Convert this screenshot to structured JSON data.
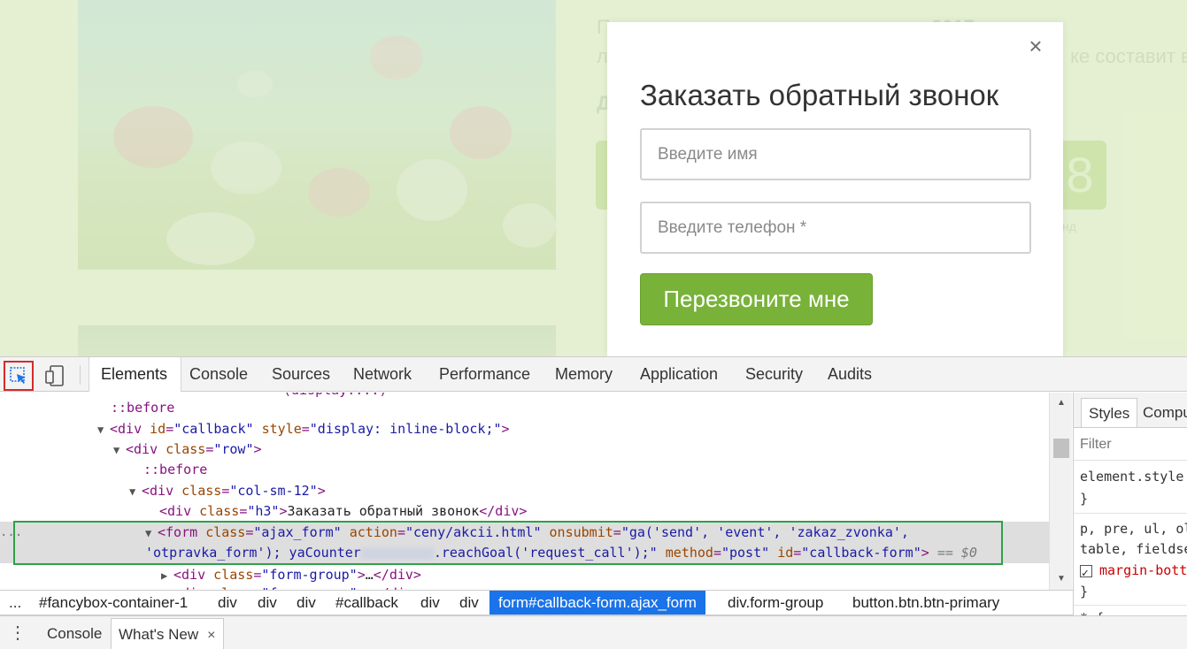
{
  "background_page": {
    "text_line1_start": "П",
    "text_line1_year": "2017",
    "text_line1_end": "цена на",
    "text_line2_start": "л",
    "text_line2_end": "ке составит в",
    "text_line3_start": "Д",
    "counter_digit": "8",
    "counter_label": "нд"
  },
  "modal": {
    "close_label": "×",
    "title": "Заказать обратный звонок",
    "name_placeholder": "Введите имя",
    "phone_placeholder": "Введите телефон *",
    "submit_label": "Перезвоните мне"
  },
  "devtools": {
    "tabs": [
      "Elements",
      "Console",
      "Sources",
      "Network",
      "Performance",
      "Memory",
      "Application",
      "Security",
      "Audits"
    ],
    "active_tab": "Elements",
    "dom": {
      "line_top_partial": "(display:...)",
      "before1": "::before",
      "div_callback_tag": "div",
      "div_callback_id_attr": "id",
      "div_callback_id_val": "\"callback\"",
      "div_callback_style_attr": "style",
      "div_callback_style_val": "\"display: inline-block;\"",
      "row_class_val": "\"row\"",
      "before2": "::before",
      "col_class_val": "\"col-sm-12\"",
      "h3_class_val": "\"h3\"",
      "h3_text": "Заказать обратный звонок",
      "form_class_val": "\"ajax_form\"",
      "form_action_val": "\"ceny/akcii.html\"",
      "form_onsubmit_val": "\"ga('send', 'event', 'zakaz_zvonka',",
      "form_onsubmit_val2": "'otpravka_form'); yaCounter",
      "form_onsubmit_val3": ".reachGoal('request_call');\"",
      "form_method_val": "\"post\"",
      "form_id_val": "\"callback-form\"",
      "dollar_ref": "== $0",
      "form_group_class_val": "\"form-group\"",
      "collapsed_ellipsis": "…",
      "left_dots": "..."
    },
    "styles": {
      "tabs": [
        "Styles",
        "Computed"
      ],
      "filter_placeholder": "Filter",
      "element_style": "element.style {",
      "close_brace": "}",
      "selector_line1": "p, pre, ul, ol,",
      "selector_line2": "table, fieldset",
      "property": "margin-bottom",
      "next_rule": "* {"
    },
    "breadcrumbs": [
      "...",
      "#fancybox-container-1",
      "div",
      "div",
      "div",
      "#callback",
      "div",
      "div",
      "form#callback-form.ajax_form",
      "div.form-group",
      "button.btn.btn-primary"
    ],
    "active_breadcrumb": "form#callback-form.ajax_form",
    "drawer": {
      "menu_icon": "⋮",
      "tabs": [
        "Console",
        "What's New"
      ],
      "active_tab": "What's New",
      "close_label": "×"
    }
  },
  "colors": {
    "accent_green": "#78b239",
    "selection_blue": "#1a73e8",
    "highlight_box_green": "#2fa14a",
    "inspect_box_red": "#d62a2a"
  }
}
